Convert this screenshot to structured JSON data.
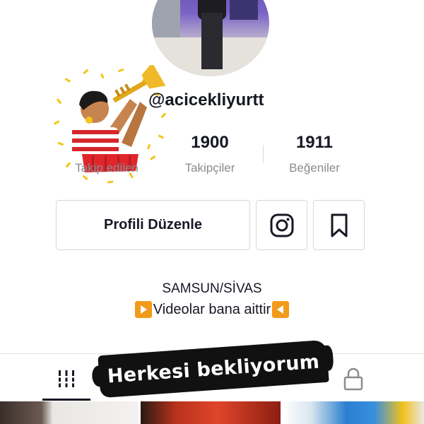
{
  "profile": {
    "username": "@acicekliyurtt",
    "bio_line1": "SAMSUN/SİVAS",
    "bio_line2": "Videolar bana aittir"
  },
  "stats": [
    {
      "value": "",
      "label": "Takip edilen"
    },
    {
      "value": "1900",
      "label": "Takipçiler"
    },
    {
      "value": "1911",
      "label": "Beğeniler"
    }
  ],
  "actions": {
    "edit_profile_label": "Profili Düzenle",
    "instagram_icon": "instagram-icon",
    "bookmark_icon": "bookmark-icon"
  },
  "tabs": [
    {
      "icon": "grid-icon",
      "selected": true
    },
    {
      "icon": "liked-icon",
      "selected": false
    },
    {
      "icon": "lock-icon",
      "selected": false
    }
  ],
  "overlay": {
    "caption": "Herkesi bekliyorum"
  },
  "colors": {
    "primary_text": "#161823",
    "secondary_text": "#8a8b91",
    "border": "#d6d7da",
    "arrow_emoji_bg": "#f29a1a"
  }
}
